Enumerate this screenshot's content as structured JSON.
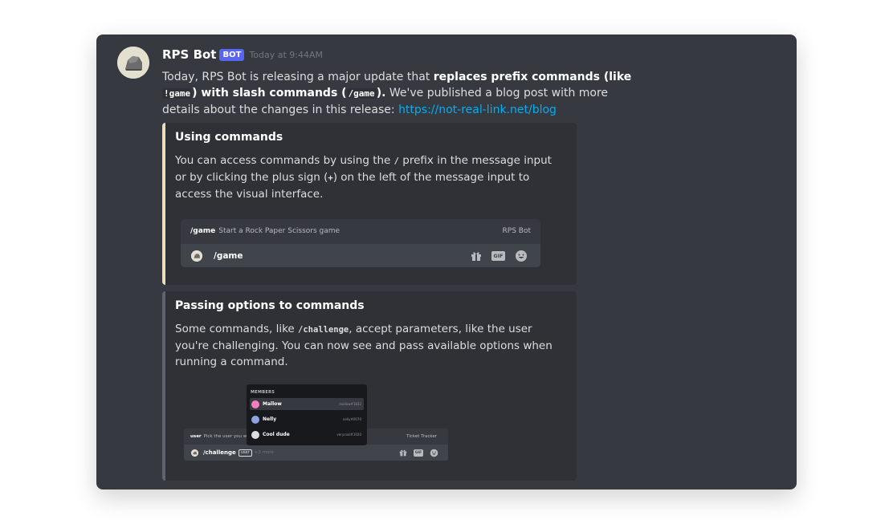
{
  "message": {
    "author": "RPS Bot",
    "bot_tag": "BOT",
    "timestamp": "Today at 9:44AM",
    "text_1": "Today, RPS Bot is releasing a major update that ",
    "bold_1": "replaces prefix commands (like ",
    "code_1": "!game",
    "bold_2": ") with slash commands (",
    "code_2": "/game",
    "bold_3": ").",
    "text_2": " We've published a blog post with more details about the changes in this release: ",
    "link": "https://not-real-link.net/blog"
  },
  "embed_1": {
    "accent_color": "#e9dfbf",
    "title": "Using commands",
    "desc_1": "You can access commands by using the ",
    "desc_code_1": "/",
    "desc_2": " prefix in the message input or by clicking the plus sign (",
    "desc_code_2": "+",
    "desc_3": ") on the left of the message input to access the visual interface.",
    "image": {
      "command": "/game",
      "description": "Start a Rock Paper Scissors game",
      "app": "RPS Bot",
      "input_command": "/game",
      "icons": [
        "gift-icon",
        "gif-icon",
        "emoji-icon"
      ],
      "gif_label": "GIF"
    }
  },
  "embed_2": {
    "accent_color": "#5f6470",
    "title": "Passing options to commands",
    "desc_1": "Some commands, like ",
    "desc_code_1": "/challenge",
    "desc_2": ", accept parameters, like the user you're challenging. You can now see and pass available options when running a command.",
    "image": {
      "members_header": "MEMBERS",
      "members": [
        {
          "name": "Mallow",
          "tag": "mallow#1832",
          "color": "#f47fbe"
        },
        {
          "name": "Nelly",
          "tag": "nelly#0070",
          "color": "#8ea1e1"
        },
        {
          "name": "Cool dude",
          "tag": "verycool#1020",
          "color": "#dcddde"
        }
      ],
      "option_name": "user",
      "option_desc": "Pick the user you w",
      "right_label": "Ticket Tracker",
      "input_command": "/challenge",
      "input_option": "user",
      "more": "+3 more",
      "gif_label": "GIF"
    }
  },
  "colors": {
    "background": "#36393f",
    "embed_bg": "#2f3136",
    "link": "#00aff4",
    "bot_tag": "#5865f2"
  }
}
